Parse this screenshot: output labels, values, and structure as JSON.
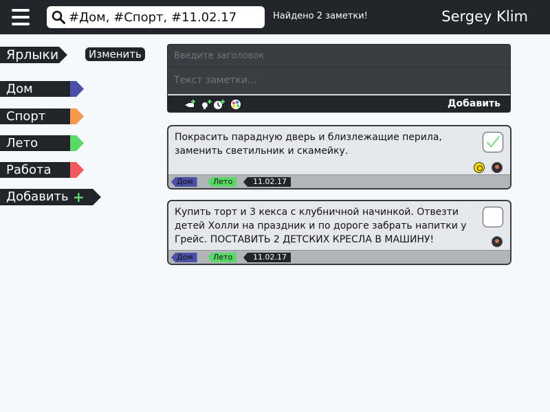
{
  "header": {
    "search_value": "#Дом, #Спорт, #11.02.17",
    "found_text": "Найдено 2 заметки!",
    "username": "Sergey Klim"
  },
  "sidebar": {
    "title": "Ярлыки",
    "edit_label": "Изменить",
    "tags": [
      {
        "label": "Дом",
        "color": "#4a4fa8"
      },
      {
        "label": "Спорт",
        "color": "#f59a4f"
      },
      {
        "label": "Лето",
        "color": "#58d866"
      },
      {
        "label": "Работа",
        "color": "#f25b5b"
      }
    ],
    "add_label": "Добавить",
    "add_plus": "+"
  },
  "new_note": {
    "title_placeholder": "Введите заголовок",
    "text_placeholder": "Текст заметки...",
    "toolbar_icons": [
      "bell-tag-icon",
      "pin-add-icon",
      "clock-add-icon",
      "palette-icon"
    ],
    "add_label": "Добавить"
  },
  "notes": [
    {
      "text": "Покрасить парадную дверь и близлежащие перила, заменить светильник и скамейку.",
      "checked": true,
      "tags": [
        "Дом",
        "Лето"
      ],
      "date": "11.02.17",
      "avatars": [
        "yellow-avatar",
        "user-avatar"
      ]
    },
    {
      "text": "Купить торт и 3 кекса с клубничной начинкой. Отвезти детей Холли на праздник и по дороге забрать напитки у Грейс. ПОСТАВИТЬ 2 ДЕТСКИХ КРЕСЛА В МАШИНУ!",
      "checked": false,
      "tags": [
        "Дом",
        "Лето"
      ],
      "date": "11.02.17",
      "avatars": [
        "user-avatar"
      ]
    }
  ]
}
